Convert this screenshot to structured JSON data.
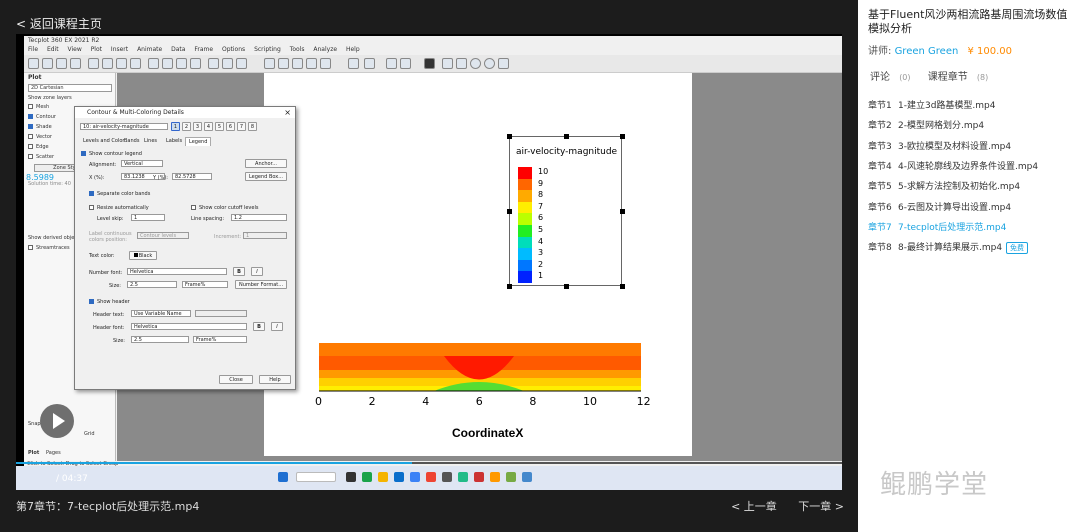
{
  "header": {
    "back_label": "< 返回课程主页"
  },
  "footer": {
    "current_chapter": "第7章节：7-tecplot后处理示范.mp4",
    "prev_label": "< 上一章",
    "next_label": "下一章 >"
  },
  "player": {
    "time": "/ 04:37",
    "progress": 0.48
  },
  "tecplot": {
    "window_title": "Tecplot 360 EX 2021 R2",
    "menu": [
      "File",
      "Edit",
      "View",
      "Plot",
      "Insert",
      "Animate",
      "Data",
      "Frame",
      "Options",
      "Scripting",
      "Tools",
      "Analyze",
      "Help"
    ],
    "left_panel": {
      "title": "Plot",
      "plot_type": "2D Cartesian",
      "show_zone_layers": "Show zone layers",
      "layers": [
        {
          "label": "Mesh",
          "on": false
        },
        {
          "label": "Contour",
          "on": true
        },
        {
          "label": "Shade",
          "on": true
        },
        {
          "label": "Vector",
          "on": false
        },
        {
          "label": "Edge",
          "on": false
        },
        {
          "label": "Scatter",
          "on": false
        }
      ],
      "zone_style": "Zone Style...",
      "solution_time": "Solution time: 40",
      "overlay_value": "8.5989",
      "derived": "Show derived objects",
      "streamtraces": "Streamtraces",
      "snap": "Snap",
      "grid": "Grid",
      "tabs": [
        "Plot",
        "Pages"
      ]
    },
    "status": "Click to Select. Drag to Select Group"
  },
  "legend": {
    "title": "air-velocity-magnitude",
    "levels": [
      "10",
      "9",
      "8",
      "7",
      "6",
      "5",
      "4",
      "3",
      "2",
      "1"
    ],
    "colors": [
      "#ff0000",
      "#ff6600",
      "#ffaa00",
      "#ffee00",
      "#bbff00",
      "#22ee22",
      "#00ddbb",
      "#00bbff",
      "#0077ff",
      "#0022ff"
    ]
  },
  "plot": {
    "xlabel": "CoordinateX",
    "xticks": [
      "0",
      "2",
      "4",
      "6",
      "8",
      "10",
      "12"
    ]
  },
  "dialog": {
    "title": "Contour & Multi-Coloring Details",
    "variable": "10: air-velocity-magnitude",
    "group_numbers": [
      "1",
      "2",
      "3",
      "4",
      "5",
      "6",
      "7",
      "8"
    ],
    "tabs": [
      "Levels and Color",
      "Bands",
      "Lines",
      "Labels",
      "Legend"
    ],
    "show_contour_legend": "Show contour legend",
    "alignment_label": "Alignment:",
    "alignment_value": "Vertical",
    "anchor": "Anchor...",
    "x_label": "X (%):",
    "x_value": "83.1238",
    "y_label": "Y (%):",
    "y_value": "82.5728",
    "legend_box": "Legend Box...",
    "separate_bands": "Separate color bands",
    "resize_auto": "Resize automatically",
    "show_cutoff": "Show color cutoff levels",
    "level_skip_label": "Level skip:",
    "level_skip": "1",
    "line_spacing_label": "Line spacing:",
    "line_spacing": "1.2",
    "label_continuous": "Label continuous colors position:",
    "contour_levels": "Contour levels",
    "increment_label": "Increment:",
    "increment": "1",
    "text_color_label": "Text color:",
    "text_color": "Black",
    "number_font_label": "Number font:",
    "number_font": "Helvetica",
    "size_label": "Size:",
    "size_value": "2.5",
    "size_unit": "Frame%",
    "number_format": "Number Format...",
    "show_header": "Show header",
    "header_text_label": "Header text:",
    "header_text": "Use Variable Name",
    "header_font_label": "Header font:",
    "header_font": "Helvetica",
    "header_size": "2.5",
    "header_unit": "Frame%",
    "bold": "B",
    "italic": "I",
    "close": "Close",
    "help": "Help"
  },
  "course": {
    "title": "基于Fluent风沙两相流路基周围流场数值模拟分析",
    "teacher_label": "讲师:",
    "teacher_name": "Green Green",
    "price": "¥ 100.00",
    "tab_comments": "评论",
    "tab_comments_count": "(0)",
    "tab_chapters": "课程章节",
    "tab_chapters_count": "(8)",
    "chapters": [
      {
        "no": "章节1",
        "title": "1-建立3d路基模型.mp4"
      },
      {
        "no": "章节2",
        "title": "2-模型网格划分.mp4"
      },
      {
        "no": "章节3",
        "title": "3-欧拉模型及材料设置.mp4"
      },
      {
        "no": "章节4",
        "title": "4-风速轮廓线及边界条件设置.mp4"
      },
      {
        "no": "章节5",
        "title": "5-求解方法控制及初始化.mp4"
      },
      {
        "no": "章节6",
        "title": "6-云图及计算导出设置.mp4"
      },
      {
        "no": "章节7",
        "title": "7-tecplot后处理示范.mp4"
      },
      {
        "no": "章节8",
        "title": "8-最终计算结果展示.mp4"
      }
    ],
    "free_badge": "免费",
    "watermark": "鲲鹏学堂"
  }
}
